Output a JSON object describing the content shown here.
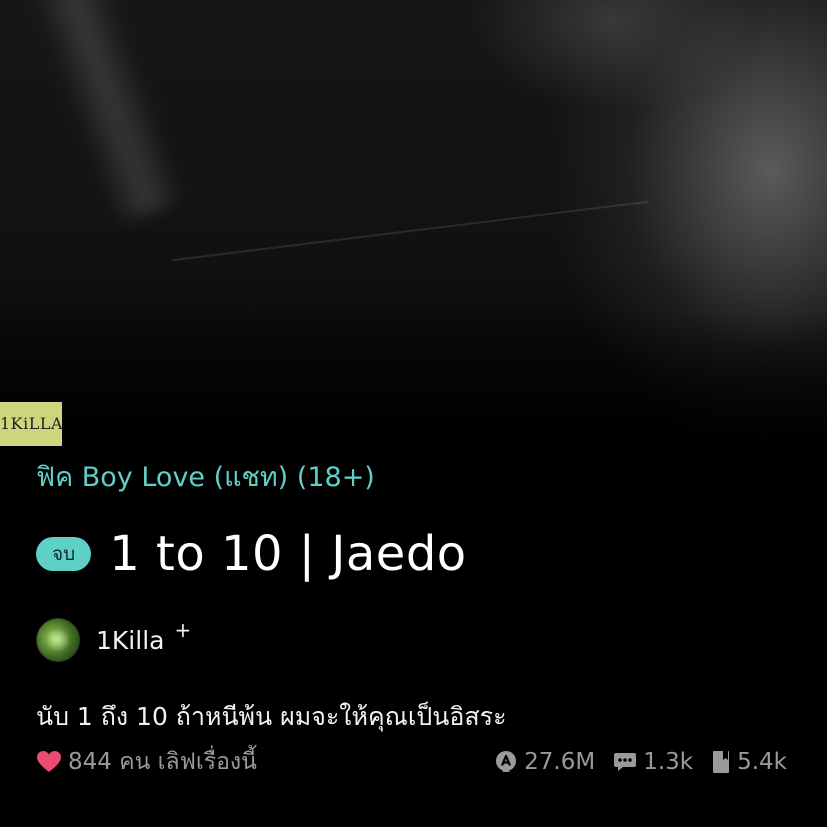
{
  "cover": {
    "watermark": "1KiLLA"
  },
  "category": "ฟิค Boy Love (แชท) (18+)",
  "status_badge": "จบ",
  "title": "1 to 10 | Jaedo",
  "author": {
    "name": "1Killa",
    "plus": "+"
  },
  "synopsis": "นับ 1 ถึง 10 ถ้าหนีพ้น ผมจะให้คุณเป็นอิสระ",
  "likes": {
    "icon": "heart-icon",
    "color": "#ec4c73",
    "text": "844 คน เลิฟเรื่องนี้"
  },
  "stats": {
    "views": {
      "icon": "read-count-icon",
      "value": "27.6M"
    },
    "comments": {
      "icon": "comment-icon",
      "value": "1.3k"
    },
    "chapters": {
      "icon": "book-icon",
      "value": "5.4k"
    }
  },
  "colors": {
    "accent": "#5fd0c8",
    "category": "#62cfc7",
    "muted": "#9a9a9a",
    "background": "#000000"
  }
}
